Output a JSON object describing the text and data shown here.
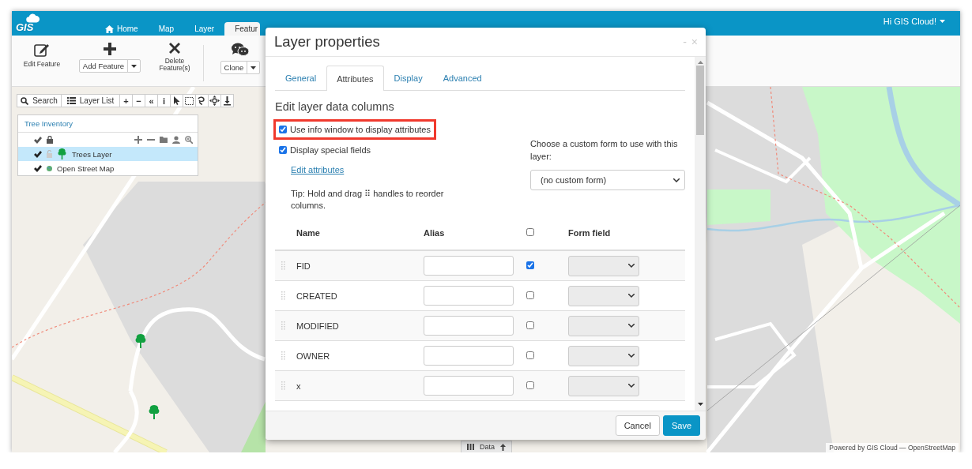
{
  "top_bar": {
    "logo": "GIS",
    "nav_tabs": [
      {
        "label": "Home",
        "selected": false
      },
      {
        "label": "Map",
        "selected": false
      },
      {
        "label": "Layer",
        "selected": false
      },
      {
        "label": "Featur",
        "selected": true
      }
    ],
    "user_menu": "Hi GIS Cloud!"
  },
  "ribbon": {
    "tools": [
      {
        "kind": "button",
        "label": "Edit Feature"
      },
      {
        "kind": "split",
        "label": "Add Feature"
      },
      {
        "kind": "button",
        "label": "Delete Feature(s)"
      },
      {
        "kind": "split",
        "label": "Clone"
      }
    ]
  },
  "map_toolbar": {
    "search": "Search",
    "layer_list": "Layer List",
    "glyph_buttons": [
      "+",
      "−",
      "«",
      "i"
    ]
  },
  "layer_panel": {
    "title": "Tree Inventory",
    "layers": [
      {
        "name": "Trees Layer",
        "kind": "vector",
        "visible": true,
        "selected": true
      },
      {
        "name": "Open Street Map",
        "kind": "basemap",
        "visible": true,
        "selected": false
      }
    ]
  },
  "data_tab": "Data",
  "attribution": "Powered by GIS Cloud — OpenStreetMap",
  "dialog": {
    "title": "Layer properties",
    "minimize": "-",
    "close": "×",
    "tabs": [
      {
        "label": "General",
        "selected": false
      },
      {
        "label": "Attributes",
        "selected": true
      },
      {
        "label": "Display",
        "selected": false
      },
      {
        "label": "Advanced",
        "selected": false
      }
    ],
    "heading": "Edit layer data columns",
    "options": [
      {
        "label": "Use info window to display attributes",
        "checked": true,
        "highlighted": true
      },
      {
        "label": "Display special fields",
        "checked": true,
        "highlighted": false
      }
    ],
    "edit_link": "Edit attributes",
    "tip": "Tip: Hold and drag ⠿ handles to reorder columns.",
    "custom_form": {
      "label": "Choose a custom form to use with this layer:",
      "value": "(no custom form)"
    },
    "table": {
      "name_header": "Name",
      "alias_header": "Alias",
      "header_checked": false,
      "form_field_header": "Form field",
      "rows": [
        {
          "name": "FID",
          "checked": true
        },
        {
          "name": "CREATED",
          "checked": false
        },
        {
          "name": "MODIFIED",
          "checked": false
        },
        {
          "name": "OWNER",
          "checked": false
        },
        {
          "name": "x",
          "checked": false
        }
      ]
    },
    "buttons": [
      {
        "label": "Cancel",
        "kind": "secondary"
      },
      {
        "label": "Save",
        "kind": "primary"
      }
    ]
  }
}
